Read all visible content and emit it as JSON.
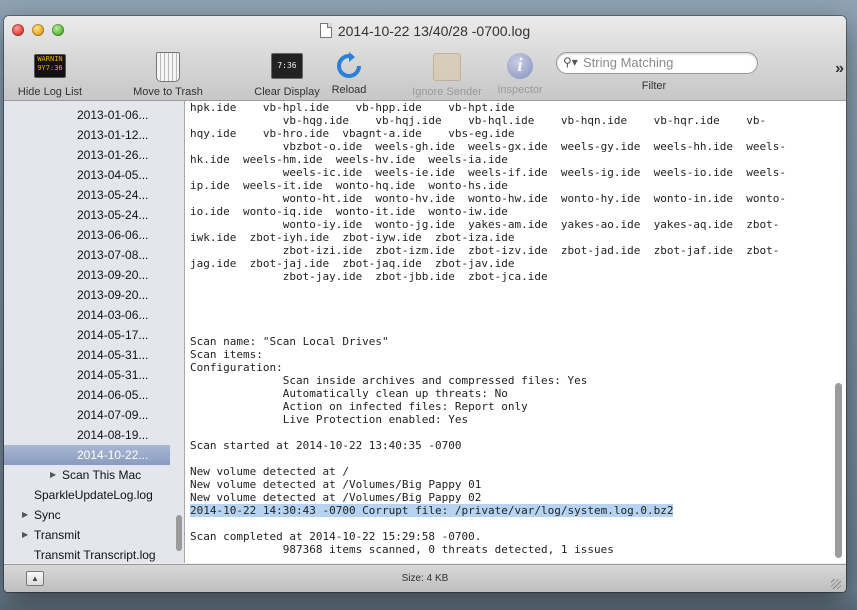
{
  "window": {
    "title": "2014-10-22 13/40/28 -0700.log"
  },
  "toolbar": {
    "hide_log_list": "Hide Log List",
    "move_to_trash": "Move to Trash",
    "clear_display": "Clear Display",
    "reload": "Reload",
    "ignore_sender": "Ignore Sender",
    "inspector": "Inspector",
    "filter_label": "Filter",
    "warn_icon_text": "WARNIN\n9Y7:36",
    "clear_icon_text": "7:36"
  },
  "search": {
    "placeholder": "String Matching"
  },
  "sidebar": {
    "items": [
      {
        "label": "2013-01-06...",
        "indent": 2
      },
      {
        "label": "2013-01-12...",
        "indent": 2
      },
      {
        "label": "2013-01-26...",
        "indent": 2
      },
      {
        "label": "2013-04-05...",
        "indent": 2
      },
      {
        "label": "2013-05-24...",
        "indent": 2
      },
      {
        "label": "2013-05-24...",
        "indent": 2
      },
      {
        "label": "2013-06-06...",
        "indent": 2
      },
      {
        "label": "2013-07-08...",
        "indent": 2
      },
      {
        "label": "2013-09-20...",
        "indent": 2
      },
      {
        "label": "2013-09-20...",
        "indent": 2
      },
      {
        "label": "2014-03-06...",
        "indent": 2
      },
      {
        "label": "2014-05-17...",
        "indent": 2
      },
      {
        "label": "2014-05-31...",
        "indent": 2
      },
      {
        "label": "2014-05-31...",
        "indent": 2
      },
      {
        "label": "2014-06-05...",
        "indent": 2
      },
      {
        "label": "2014-07-09...",
        "indent": 2
      },
      {
        "label": "2014-08-19...",
        "indent": 2
      },
      {
        "label": "2014-10-22...",
        "indent": 2,
        "selected": true
      },
      {
        "label": "Scan This Mac",
        "indent": 1,
        "disclosure": true
      },
      {
        "label": "SparkleUpdateLog.log",
        "indent": 0
      },
      {
        "label": "Sync",
        "indent": 0,
        "disclosure": true
      },
      {
        "label": "Transmit",
        "indent": 0,
        "disclosure": true
      },
      {
        "label": "Transmit Transcript.log",
        "indent": 0
      }
    ]
  },
  "log": {
    "lines": [
      "hpk.ide    vb-hpl.ide    vb-hpp.ide    vb-hpt.ide",
      "              vb-hqg.ide    vb-hqj.ide    vb-hql.ide    vb-hqn.ide    vb-hqr.ide    vb-",
      "hqy.ide    vb-hro.ide  vbagnt-a.ide    vbs-eg.ide",
      "              vbzbot-o.ide  weels-gh.ide  weels-gx.ide  weels-gy.ide  weels-hh.ide  weels-",
      "hk.ide  weels-hm.ide  weels-hv.ide  weels-ia.ide",
      "              weels-ic.ide  weels-ie.ide  weels-if.ide  weels-ig.ide  weels-io.ide  weels-",
      "ip.ide  weels-it.ide  wonto-hq.ide  wonto-hs.ide",
      "              wonto-ht.ide  wonto-hv.ide  wonto-hw.ide  wonto-hy.ide  wonto-in.ide  wonto-",
      "io.ide  wonto-iq.ide  wonto-it.ide  wonto-iw.ide",
      "              wonto-iy.ide  wonto-jg.ide  yakes-am.ide  yakes-ao.ide  yakes-aq.ide  zbot-",
      "iwk.ide  zbot-iyh.ide  zbot-iyw.ide  zbot-iza.ide",
      "              zbot-izi.ide  zbot-izm.ide  zbot-izv.ide  zbot-jad.ide  zbot-jaf.ide  zbot-",
      "jag.ide  zbot-jaj.ide  zbot-jaq.ide  zbot-jav.ide",
      "              zbot-jay.ide  zbot-jbb.ide  zbot-jca.ide",
      "",
      "",
      "",
      "",
      "Scan name: \"Scan Local Drives\"",
      "Scan items:",
      "Configuration:",
      "              Scan inside archives and compressed files: Yes",
      "              Automatically clean up threats: No",
      "              Action on infected files: Report only",
      "              Live Protection enabled: Yes",
      "",
      "Scan started at 2014-10-22 13:40:35 -0700",
      "",
      "New volume detected at /",
      "New volume detected at /Volumes/Big Pappy 01",
      "New volume detected at /Volumes/Big Pappy 02",
      "2014-10-22 14:30:43 -0700 Corrupt file: /private/var/log/system.log.0.bz2",
      "",
      "Scan completed at 2014-10-22 15:29:58 -0700.",
      "              987368 items scanned, 0 threats detected, 1 issues"
    ],
    "highlighted_line": 31
  },
  "status": {
    "size": "Size: 4 KB"
  },
  "colors": {
    "selection": "#b6d4f2",
    "sidebar_bg": "#e3e7ed",
    "sidebar_selected": "#8a9cbf"
  }
}
